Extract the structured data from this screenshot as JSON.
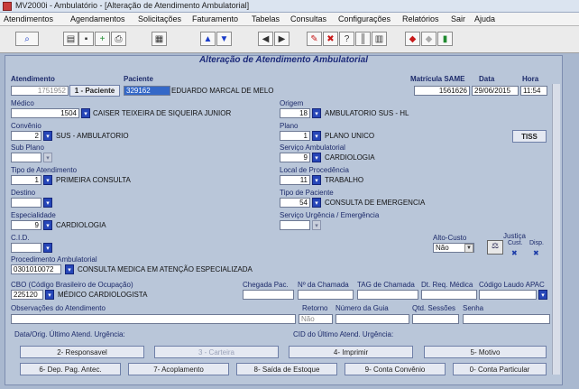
{
  "window": {
    "title": "MV2000i - Ambulatório - [Alteração de Atendimento Ambulatorial]"
  },
  "menu": [
    "Atendimentos",
    "Agendamentos",
    "Solicitações",
    "Faturamento",
    "Tabelas",
    "Consultas",
    "Configurações",
    "Relatórios",
    "Sair",
    "Ajuda"
  ],
  "toolbar": {
    "icons": [
      "find-icon",
      "card-icon",
      "save-icon",
      "add-icon",
      "print-icon",
      "calc-icon",
      "up-arrow-icon",
      "down-arrow-icon",
      "first-icon",
      "prev-icon",
      "edit-icon",
      "delete-icon",
      "help-icon",
      "barcode-icon",
      "chart-icon",
      "red-record-icon",
      "grey-record-icon",
      "exit-icon"
    ]
  },
  "panel": {
    "title": "Alteração de Atendimento Ambulatorial"
  },
  "header": {
    "atendimento_label": "Atendimento",
    "atendimento": "1751952",
    "paciente_btn": "1 - Paciente",
    "paciente_label": "Paciente",
    "paciente_code": "329162",
    "paciente_name": "EDUARDO MARCAL DE MELO",
    "matricula_label": "Matrícula SAME",
    "matricula": "1561626",
    "data_label": "Data",
    "data": "29/06/2015",
    "hora_label": "Hora",
    "hora": "11:54"
  },
  "fields": {
    "medico_label": "Médico",
    "medico_code": "1504",
    "medico_name": "CAISER TEIXEIRA DE SIQUEIRA JUNIOR",
    "origem_label": "Origem",
    "origem_code": "18",
    "origem_name": "AMBULATORIO SUS - HL",
    "convenio_label": "Convênio",
    "convenio_code": "2",
    "convenio_name": "SUS - AMBULATORIO",
    "plano_label": "Plano",
    "plano_code": "1",
    "plano_name": "PLANO UNICO",
    "tiss_btn": "TISS",
    "subplano_label": "Sub Plano",
    "servico_label": "Serviço Ambulatorial",
    "servico_code": "9",
    "servico_name": "CARDIOLOGIA",
    "tipo_label": "Tipo de Atendimento",
    "tipo_code": "1",
    "tipo_name": "PRIMEIRA CONSULTA",
    "local_label": "Local de Procedência",
    "local_code": "11",
    "local_name": "TRABALHO",
    "destino_label": "Destino",
    "tipopac_label": "Tipo de Paciente",
    "tipopac_code": "54",
    "tipopac_name": "CONSULTA DE EMERGENCIA",
    "especialidade_label": "Especialidade",
    "especialidade_code": "9",
    "especialidade_name": "CARDIOLOGIA",
    "servurg_label": "Serviço Urgência / Emergência",
    "cid_label": "C.I.D.",
    "altocusto_label": "Alto-Custo",
    "altocusto_value": "Não",
    "justica_label": "Justiça",
    "cust_label": "Cust.",
    "disp_label": "Disp.",
    "proc_label": "Procedimento Ambulatorial",
    "proc_code": "0301010072",
    "proc_name": "CONSULTA MEDICA EM ATENÇÃO ESPECIALIZADA",
    "cbo_label": "CBO (Código Brasileiro de Ocupação)",
    "cbo_code": "225120",
    "cbo_name": "MÉDICO CARDIOLOGISTA",
    "chegada_label": "Chegada Pac.",
    "chamada_label": "Nº da Chamada",
    "tag_label": "TAG de Chamada",
    "dtreq_label": "Dt. Req. Médica",
    "laudo_label": "Código Laudo APAC",
    "obs_label": "Observações do Atendimento",
    "retorno_label": "Retorno",
    "retorno_value": "Não",
    "guia_label": "Número da Guia",
    "sessoes_label": "Qtd. Sessões",
    "senha_label": "Senha",
    "dataorig_label": "Data/Orig. Último Atend. Urgência:",
    "cidult_label": "CID do Último Atend. Urgência:"
  },
  "buttons": {
    "responsavel": "2- Responsavel",
    "carteira": "3 - Carteira",
    "imprimir": "4- Imprimir",
    "motivo": "5- Motivo",
    "dep": "6- Dep. Pag. Antec.",
    "acoplamento": "7- Acoplamento",
    "saida": "8- Saída de Estoque",
    "conta_conv": "9- Conta Convênio",
    "conta_part": "0- Conta Particular"
  }
}
